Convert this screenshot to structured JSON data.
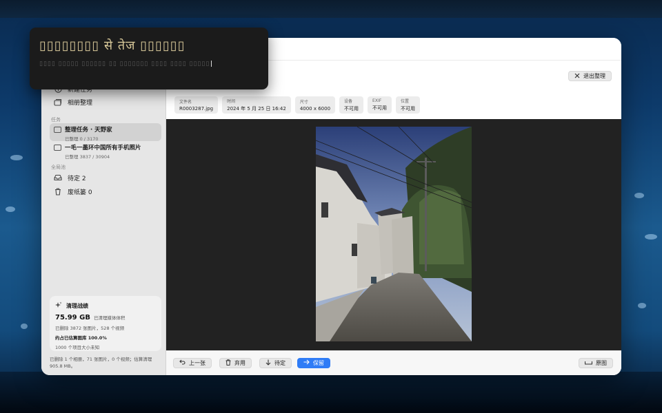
{
  "overlay": {
    "title": "▯▯▯▯▯▯▯▯ से तेज ▯▯▯▯▯▯",
    "subtitle": "▯▯▯▯ ▯▯▯▯▯ ▯▯▯▯▯▯ ▯▯ ▯▯▯▯▯▯▯ ▯▯▯▯ ▯▯▯▯ ▯▯▯▯▯"
  },
  "sidebar": {
    "top_items": [
      {
        "label": "新建任务",
        "icon": "plus-circle-icon"
      },
      {
        "label": "相册整理",
        "icon": "albums-icon"
      }
    ],
    "tasks_section": "任务",
    "tasks": [
      {
        "title": "整理任务 · 天野家",
        "subtitle": "已整理 0 / 3170"
      },
      {
        "title": "一毛一墨环中国所有手机照片",
        "subtitle": "已整理 3837 / 30904"
      }
    ],
    "pool_section": "全局池",
    "pool_items": [
      {
        "label": "待定 2",
        "icon": "tray-icon"
      },
      {
        "label": "废纸篓 0",
        "icon": "trash-icon"
      }
    ],
    "stats": {
      "title": "清理战绩",
      "size": "75.99 GB",
      "size_label": "已清理媒体体积",
      "deleted": "已删除 3872 张图片，528 个视频",
      "share": "约占已估算图库 100.0%",
      "unknown": "1000 个项目大小未知"
    },
    "footer": "已删除 1 个相册，71 张图片，0 个视频；估算清理 905.8 MB。"
  },
  "main": {
    "exit_label": "退出整理",
    "meta": [
      {
        "key": "文件名",
        "value": "R0003287.jpg"
      },
      {
        "key": "时间",
        "value": "2024 年 5 月 25 日 16:42"
      },
      {
        "key": "尺寸",
        "value": "4000 x 6000"
      },
      {
        "key": "设备",
        "value": "不可用"
      },
      {
        "key": "EXIF",
        "value": "不可用"
      },
      {
        "key": "位置",
        "value": "不可用"
      }
    ],
    "actions": {
      "prev": "上一张",
      "discard": "弃用",
      "pending": "待定",
      "keep": "保留",
      "original": "原图"
    }
  },
  "colors": {
    "accent": "#2f7cf6",
    "sidebar_bg": "#e6e6e6",
    "viewer_bg": "#222222"
  }
}
